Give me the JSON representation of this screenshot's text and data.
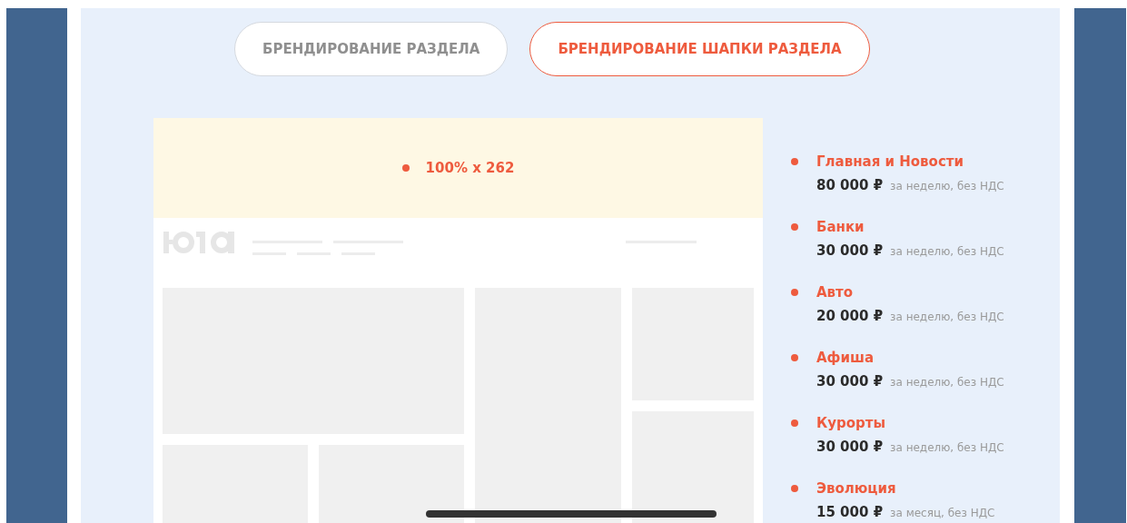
{
  "tabs": [
    {
      "label": "БРЕНДИРОВАНИЕ РАЗДЕЛА",
      "selected": false
    },
    {
      "label": "БРЕНДИРОВАНИЕ ШАПКИ РАЗДЕЛА",
      "selected": true
    }
  ],
  "mockup": {
    "banner_size": "100% x 262"
  },
  "prices": [
    {
      "section": "Главная и Новости",
      "price": "80 000 ₽",
      "terms": "за неделю, без НДС"
    },
    {
      "section": "Банки",
      "price": "30 000 ₽",
      "terms": "за неделю, без НДС"
    },
    {
      "section": "Авто",
      "price": "20 000 ₽",
      "terms": "за неделю, без НДС"
    },
    {
      "section": "Афиша",
      "price": "30 000 ₽",
      "terms": "за неделю, без НДС"
    },
    {
      "section": "Курорты",
      "price": "30 000 ₽",
      "terms": "за неделю, без НДС"
    },
    {
      "section": "Эволюция",
      "price": "15 000 ₽",
      "terms": "за месяц, без НДС"
    }
  ]
}
